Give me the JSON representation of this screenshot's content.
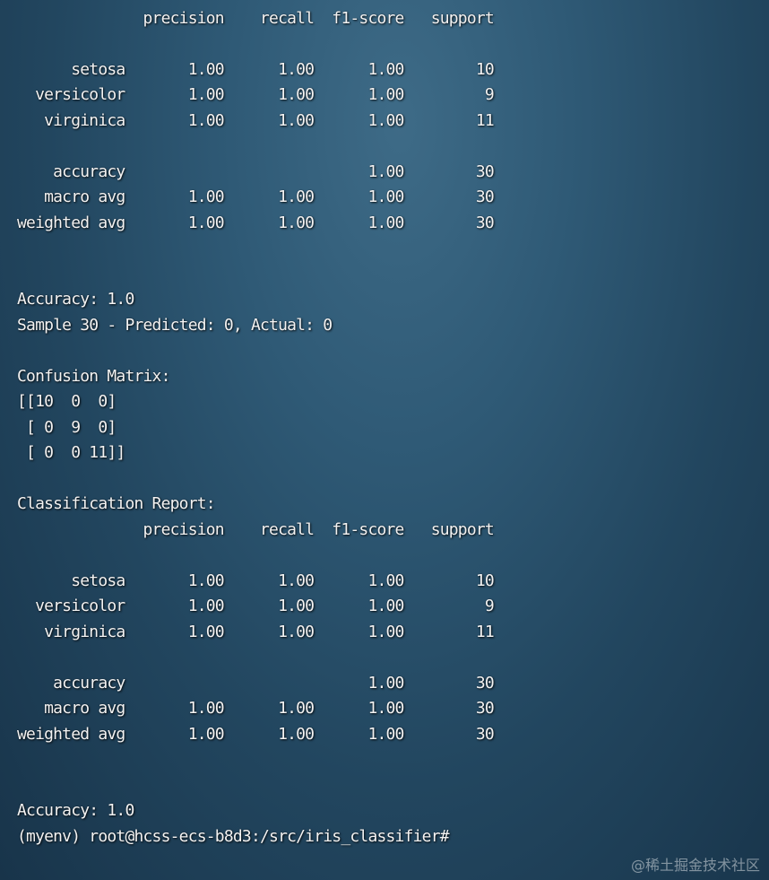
{
  "terminal": {
    "lines": [
      "              precision    recall  f1-score   support",
      "",
      "      setosa       1.00      1.00      1.00        10",
      "  versicolor       1.00      1.00      1.00         9",
      "   virginica       1.00      1.00      1.00        11",
      "",
      "    accuracy                           1.00        30",
      "   macro avg       1.00      1.00      1.00        30",
      "weighted avg       1.00      1.00      1.00        30",
      "",
      "",
      "Accuracy: 1.0",
      "Sample 30 - Predicted: 0, Actual: 0",
      "",
      "Confusion Matrix:",
      "[[10  0  0]",
      " [ 0  9  0]",
      " [ 0  0 11]]",
      "",
      "Classification Report:",
      "              precision    recall  f1-score   support",
      "",
      "      setosa       1.00      1.00      1.00        10",
      "  versicolor       1.00      1.00      1.00         9",
      "   virginica       1.00      1.00      1.00        11",
      "",
      "    accuracy                           1.00        30",
      "   macro avg       1.00      1.00      1.00        30",
      "weighted avg       1.00      1.00      1.00        30",
      "",
      "",
      "Accuracy: 1.0",
      "(myenv) root@hcss-ecs-b8d3:/src/iris_classifier#"
    ]
  },
  "watermark": {
    "text": "@稀土掘金技术社区"
  }
}
